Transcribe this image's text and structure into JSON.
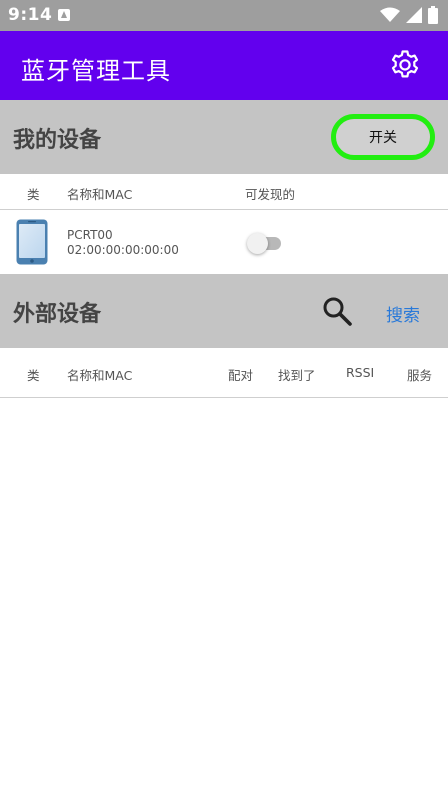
{
  "status_bar": {
    "time": "9:14",
    "icons": [
      "notification-a-icon",
      "wifi-icon",
      "signal-icon",
      "battery-icon"
    ]
  },
  "app_bar": {
    "title": "蓝牙管理工具",
    "settings_icon": "gear-icon",
    "color": "#6200ee"
  },
  "my_devices": {
    "title": "我的设备",
    "toggle_label": "开关",
    "columns": [
      "类",
      "名称和MAC",
      "可发现的"
    ],
    "devices": [
      {
        "icon": "phone-icon",
        "name": "PCRT00",
        "mac": "02:00:00:00:00:00",
        "discoverable": false
      }
    ]
  },
  "external_devices": {
    "title": "外部设备",
    "search_icon": "search-icon",
    "search_label": "搜索",
    "columns": [
      "类",
      "名称和MAC",
      "配对",
      "找到了",
      "RSSI",
      "服务"
    ]
  },
  "colors": {
    "section_bg": "#c4c4c4",
    "toggle_border": "#22ee11",
    "link": "#2979d9"
  }
}
